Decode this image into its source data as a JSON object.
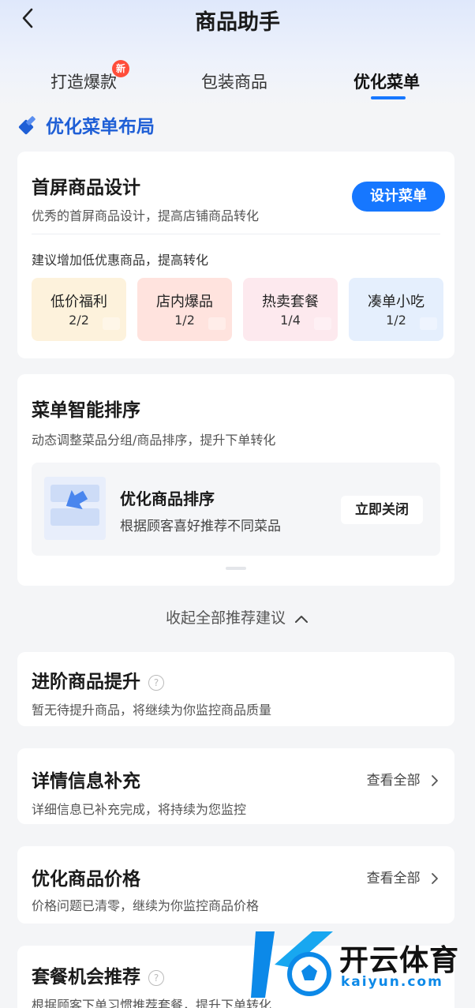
{
  "header": {
    "title": "商品助手"
  },
  "tabs": [
    {
      "label": "打造爆款",
      "badge": "新"
    },
    {
      "label": "包装商品"
    },
    {
      "label": "优化菜单"
    }
  ],
  "section_title": "优化菜单布局",
  "first_screen": {
    "title": "首屏商品设计",
    "subtitle": "优秀的首屏商品设计，提高店铺商品转化",
    "button": "设计菜单",
    "hint": "建议增加低优惠商品，提高转化",
    "tiles": [
      {
        "name": "低价福利",
        "count": "2/2",
        "bg": "#fdf2dc"
      },
      {
        "name": "店内爆品",
        "count": "1/2",
        "bg": "#ffe3de"
      },
      {
        "name": "热卖套餐",
        "count": "1/4",
        "bg": "#fde9ee"
      },
      {
        "name": "凑单小吃",
        "count": "1/2",
        "bg": "#e5effd"
      }
    ]
  },
  "smart_sort": {
    "title": "菜单智能排序",
    "subtitle": "动态调整菜品分组/商品排序，提升下单转化",
    "item_title": "优化商品排序",
    "item_desc": "根据顾客喜好推荐不同菜品",
    "button": "立即关闭"
  },
  "collapse_label": "收起全部推荐建议",
  "advanced": {
    "title": "进阶商品提升",
    "subtitle": "暂无待提升商品，将继续为你监控商品质量",
    "help": "?"
  },
  "detail_info": {
    "title": "详情信息补充",
    "subtitle": "详细信息已补充完成，将持续为您监控",
    "link": "查看全部"
  },
  "price": {
    "title": "优化商品价格",
    "subtitle": "价格问题已清零，继续为你监控商品价格",
    "link": "查看全部"
  },
  "combo": {
    "title": "套餐机会推荐",
    "subtitle": "根据顾客下单习惯推荐套餐，提升下单转化",
    "help": "?"
  },
  "watermark": {
    "brand": "开云体育",
    "url": "kaiyun.com"
  },
  "colors": {
    "accent": "#1677ff",
    "new_badge": "#ff4d3a"
  }
}
